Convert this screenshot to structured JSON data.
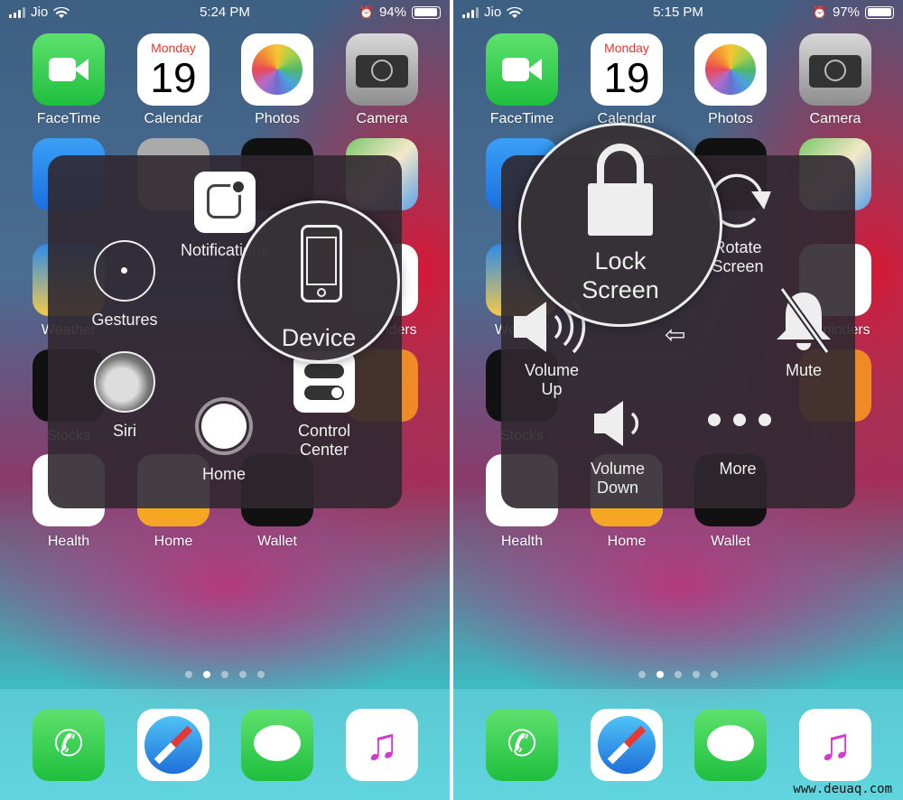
{
  "left": {
    "carrier": "Jio",
    "time": "5:24 PM",
    "battery": "94%",
    "battery_level": 0.94,
    "menu": {
      "notifications": "Notifications",
      "gestures": "Gestures",
      "siri": "Siri",
      "home": "Home",
      "control_center": [
        "Control",
        "Center"
      ],
      "device": "Device"
    }
  },
  "right": {
    "carrier": "Jio",
    "time": "5:15 PM",
    "battery": "97%",
    "battery_level": 0.97,
    "menu": {
      "lock_screen": [
        "Lock",
        "Screen"
      ],
      "rotate_screen": [
        "Rotate",
        "Screen"
      ],
      "volume_up": [
        "Volume",
        "Up"
      ],
      "mute": "Mute",
      "volume_down": [
        "Volume",
        "Down"
      ],
      "more": "More"
    }
  },
  "apps": {
    "row1": [
      "FaceTime",
      "Calendar",
      "Photos",
      "Camera"
    ],
    "calendar_day": "Monday",
    "calendar_date": "19",
    "row3": [
      "Weather",
      "Reminders"
    ],
    "row4": [
      "Stocks"
    ],
    "row5": [
      "Health",
      "Home",
      "Wallet"
    ]
  },
  "dock": [
    "Phone",
    "Safari",
    "Messages",
    "Music"
  ],
  "page_dots": {
    "count": 5,
    "active": 1
  },
  "watermark": "www.deuaq.com",
  "colors": {
    "facetime": "#2fcf4e",
    "calendar_red": "#e8352c",
    "phone": "#35c653",
    "messages": "#34c759"
  }
}
